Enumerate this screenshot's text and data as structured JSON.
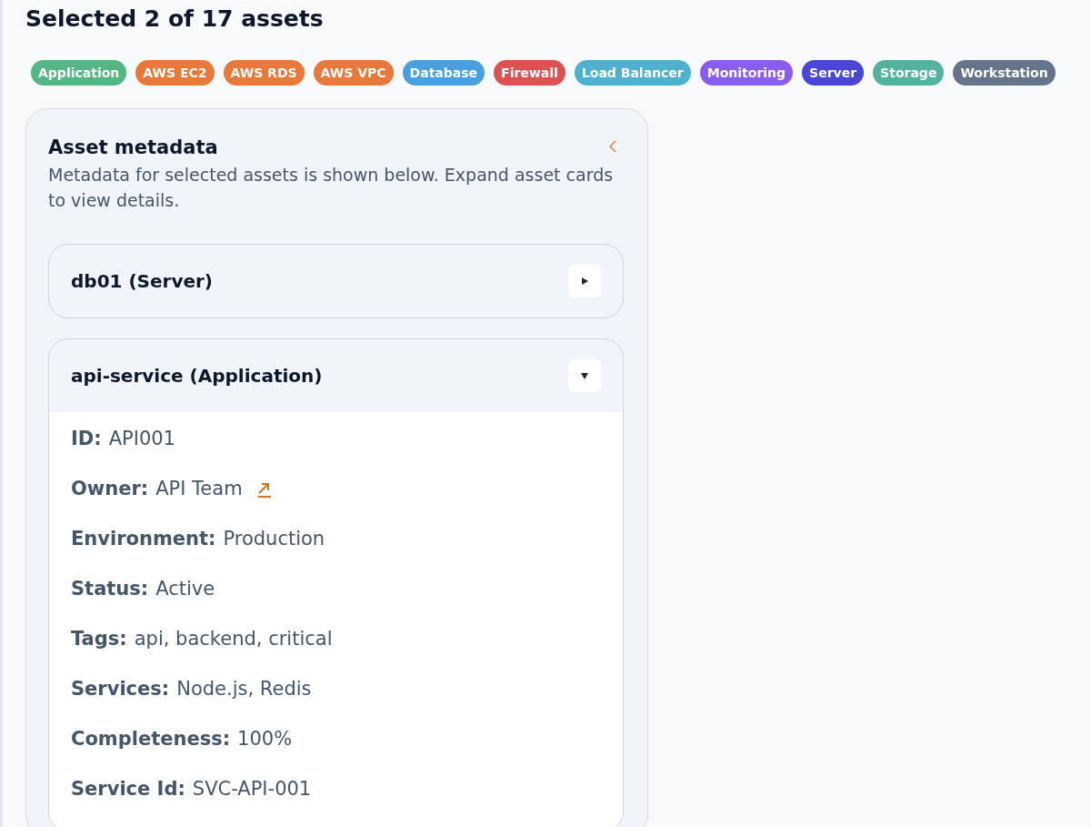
{
  "heading": "Selected 2 of 17 assets",
  "tags": [
    {
      "label": "Application",
      "color": "#55b685"
    },
    {
      "label": "AWS EC2",
      "color": "#e8793a"
    },
    {
      "label": "AWS RDS",
      "color": "#e8793a"
    },
    {
      "label": "AWS VPC",
      "color": "#e8793a"
    },
    {
      "label": "Database",
      "color": "#4a9fe0"
    },
    {
      "label": "Firewall",
      "color": "#dd5250"
    },
    {
      "label": "Load Balancer",
      "color": "#4fb0cf"
    },
    {
      "label": "Monitoring",
      "color": "#8b5cf0"
    },
    {
      "label": "Server",
      "color": "#4b45d8"
    },
    {
      "label": "Storage",
      "color": "#53b3a0"
    },
    {
      "label": "Workstation",
      "color": "#64748b"
    }
  ],
  "panel": {
    "title": "Asset metadata",
    "description": "Metadata for selected assets is shown below. Expand asset cards to view details.",
    "cards": [
      {
        "title": "db01 (Server)",
        "expanded": false
      },
      {
        "title": "api-service (Application)",
        "expanded": true,
        "fields": [
          {
            "label": "ID:",
            "value": "API001",
            "link": false
          },
          {
            "label": "Owner:",
            "value": "API Team",
            "link": true
          },
          {
            "label": "Environment:",
            "value": "Production",
            "link": false
          },
          {
            "label": "Status:",
            "value": "Active",
            "link": false
          },
          {
            "label": "Tags:",
            "value": "api, backend, critical",
            "link": false
          },
          {
            "label": "Services:",
            "value": "Node.js, Redis",
            "link": false
          },
          {
            "label": "Completeness:",
            "value": "100%",
            "link": false
          },
          {
            "label": "Service Id:",
            "value": "SVC-API-001",
            "link": false
          }
        ]
      }
    ]
  }
}
